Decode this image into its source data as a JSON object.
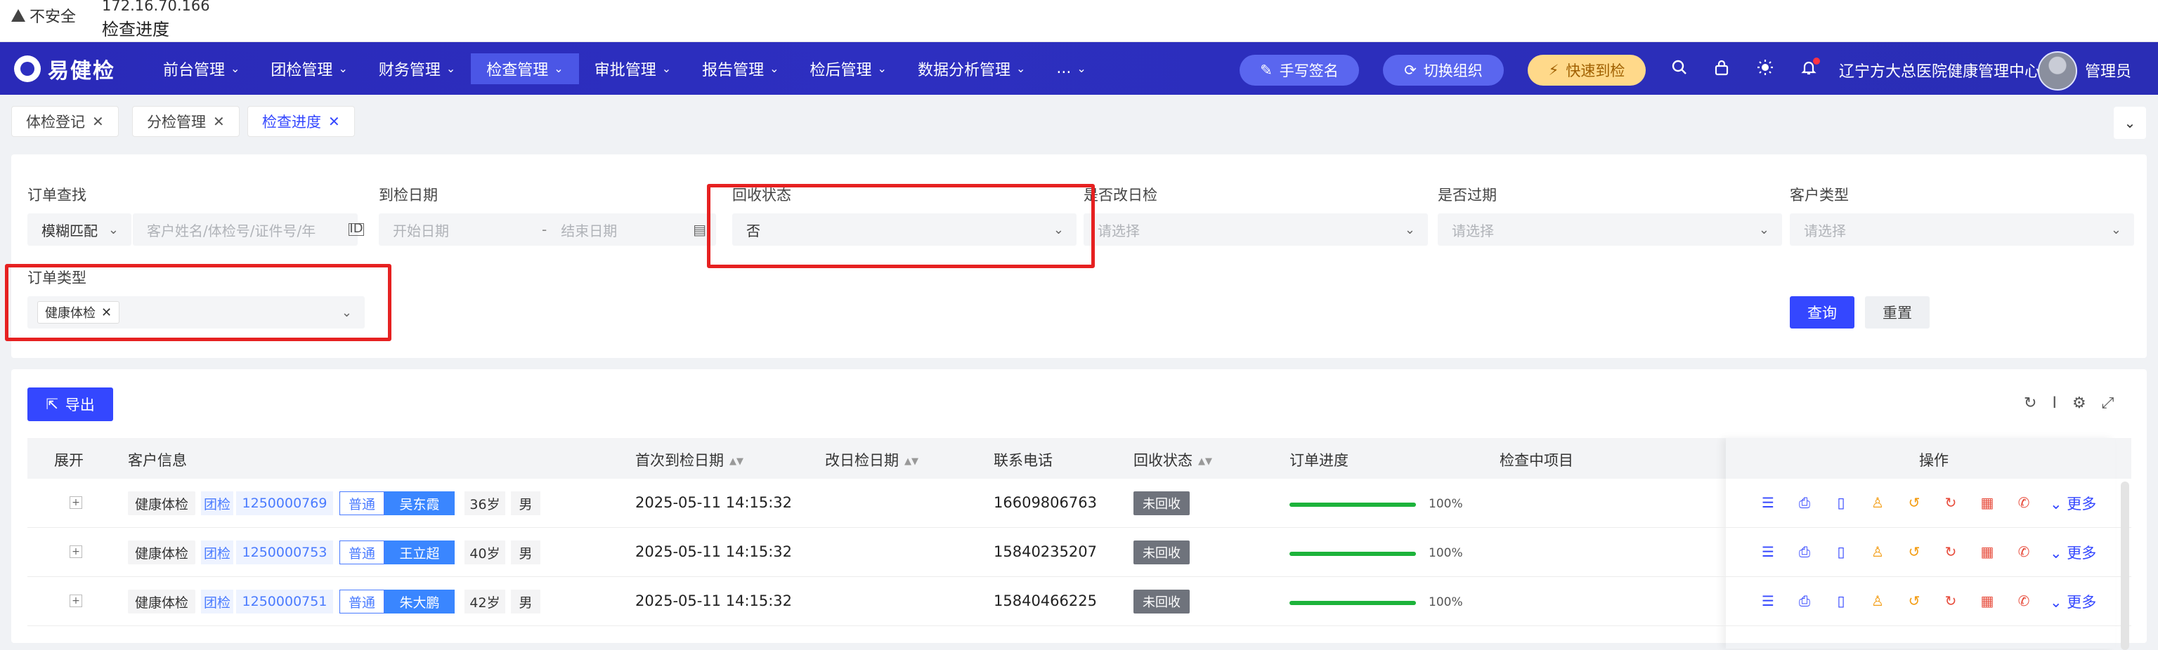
{
  "browser": {
    "warning": "不安全",
    "url": "172.16.70.166",
    "page_title": "检查进度"
  },
  "header": {
    "logo_text": "易健检",
    "nav": [
      {
        "label": "前台管理"
      },
      {
        "label": "团检管理"
      },
      {
        "label": "财务管理"
      },
      {
        "label": "检查管理",
        "active": true
      },
      {
        "label": "审批管理"
      },
      {
        "label": "报告管理"
      },
      {
        "label": "检后管理"
      },
      {
        "label": "数据分析管理"
      },
      {
        "label": "..."
      }
    ],
    "sign_btn": "手写签名",
    "switch_org_btn": "切换组织",
    "quick_checkin_btn": "快速到检",
    "org_name": "辽宁方大总医院健康管理中心",
    "user_name": "管理员"
  },
  "tabs": [
    {
      "label": "体检登记"
    },
    {
      "label": "分检管理"
    },
    {
      "label": "检查进度",
      "active": true
    }
  ],
  "filters": {
    "order_search_label": "订单查找",
    "match_mode": "模糊匹配",
    "order_search_placeholder": "客户姓名/体检号/证件号/年",
    "checkin_date_label": "到检日期",
    "start_date_placeholder": "开始日期",
    "date_separator": "-",
    "end_date_placeholder": "结束日期",
    "recycle_status_label": "回收状态",
    "recycle_status_value": "否",
    "change_date_label": "是否改日检",
    "change_date_placeholder": "请选择",
    "expired_label": "是否过期",
    "expired_placeholder": "请选择",
    "customer_type_label": "客户类型",
    "customer_type_placeholder": "请选择",
    "order_type_label": "订单类型",
    "order_type_tag": "健康体检",
    "query_btn": "查询",
    "reset_btn": "重置"
  },
  "table": {
    "export_btn": "导出",
    "columns": {
      "expand": "展开",
      "customer": "客户信息",
      "first_date": "首次到检日期",
      "change_date": "改日检日期",
      "phone": "联系电话",
      "recycle": "回收状态",
      "progress": "订单进度",
      "checking_items": "检查中项目",
      "ops": "操作"
    },
    "more_label": "更多",
    "rows": [
      {
        "type": "健康体检",
        "group": "团检",
        "code": "1250000769",
        "level": "普通",
        "name": "吴东霞",
        "age": "36岁",
        "sex": "男",
        "first_date": "2025-05-11 14:15:32",
        "phone": "16609806763",
        "recycle": "未回收",
        "progress": 100,
        "progress_text": "100%"
      },
      {
        "type": "健康体检",
        "group": "团检",
        "code": "1250000753",
        "level": "普通",
        "name": "王立超",
        "age": "40岁",
        "sex": "男",
        "first_date": "2025-05-11 14:15:32",
        "phone": "15840235207",
        "recycle": "未回收",
        "progress": 100,
        "progress_text": "100%"
      },
      {
        "type": "健康体检",
        "group": "团检",
        "code": "1250000751",
        "level": "普通",
        "name": "朱大鹏",
        "age": "42岁",
        "sex": "男",
        "first_date": "2025-05-11 14:15:32",
        "phone": "15840466225",
        "recycle": "未回收",
        "progress": 100,
        "progress_text": "100%"
      }
    ]
  },
  "colors": {
    "header_bg": "#2d2fc0",
    "primary": "#3447ff",
    "highlight_red": "#e62121",
    "progress_green": "#1db33b"
  }
}
